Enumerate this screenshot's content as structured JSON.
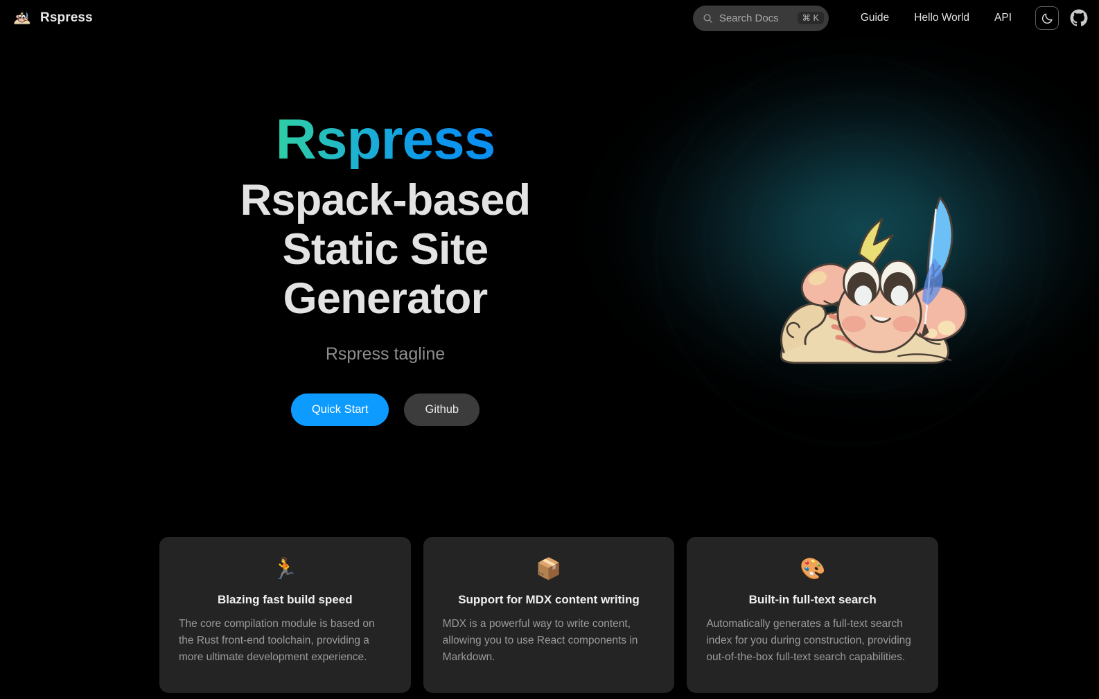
{
  "brand": {
    "name": "Rspress",
    "logo_icon": "rspress-mascot-logo"
  },
  "nav": {
    "search": {
      "placeholder": "Search Docs",
      "shortcut": "⌘ K",
      "icon": "search-icon"
    },
    "links": [
      {
        "label": "Guide"
      },
      {
        "label": "Hello World"
      },
      {
        "label": "API"
      }
    ],
    "theme_toggle": {
      "icon": "moon-icon",
      "label": "Dark mode"
    },
    "github": {
      "icon": "github-icon",
      "label": "GitHub"
    }
  },
  "hero": {
    "name": "Rspress",
    "title_line_1": "Rspack-based",
    "title_line_2": "Static Site",
    "title_line_3": "Generator",
    "tagline": "Rspress tagline",
    "primary_button": "Quick Start",
    "secondary_button": "Github",
    "mascot_icon": "rspress-mascot-illustration"
  },
  "features": [
    {
      "icon": "🏃",
      "icon_name": "running-person-emoji",
      "title": "Blazing fast build speed",
      "desc": "The core compilation module is based on the Rust front-end toolchain, providing a more ultimate development experience."
    },
    {
      "icon": "📦",
      "icon_name": "package-box-emoji",
      "title": "Support for MDX content writing",
      "desc": "MDX is a powerful way to write content, allowing you to use React components in Markdown."
    },
    {
      "icon": "🎨",
      "icon_name": "artist-palette-emoji",
      "title": "Built-in full-text search",
      "desc": "Automatically generates a full-text search index for you during construction, providing out-of-the-box full-text search capabilities."
    }
  ],
  "colors": {
    "background": "#000000",
    "accent_blue": "#0e9bff",
    "gradient_start": "#2ecfa6",
    "gradient_end": "#0a8ef5",
    "card_background": "#242424",
    "secondary_button": "#3c3c3c",
    "glow_teal": "#124a54"
  }
}
